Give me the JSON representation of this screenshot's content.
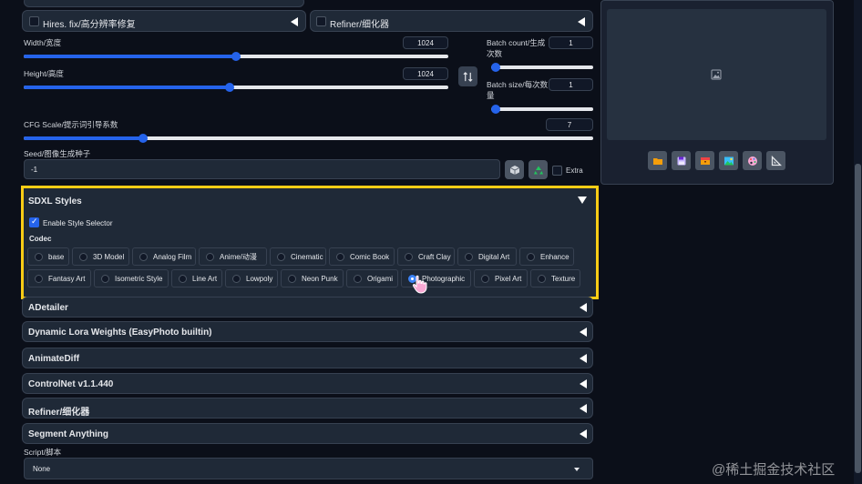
{
  "hires": {
    "label": "Hires. fix/高分辨率修复"
  },
  "refiner_top": {
    "label": "Refiner/细化器"
  },
  "width": {
    "label": "Width/宽度",
    "value": "1024",
    "fraction": 0.5
  },
  "height": {
    "label": "Height/高度",
    "value": "1024",
    "fraction": 0.5
  },
  "batch_count": {
    "label_line1": "Batch count/生成",
    "label_line2": "次数",
    "value": "1",
    "fraction": 0.0
  },
  "batch_size": {
    "label_line1": "Batch size/每次数",
    "label_line2": "量",
    "value": "1",
    "fraction": 0.0
  },
  "swap_icon": "swap-vertical-icon",
  "cfg": {
    "label": "CFG Scale/提示词引导系数",
    "value": "7",
    "fraction": 0.21
  },
  "seed": {
    "label": "Seed/图像生成种子",
    "value": "-1",
    "extra_label": "Extra"
  },
  "sdxl": {
    "title": "SDXL Styles",
    "enable_label": "Enable Style Selector",
    "codec_label": "Codec",
    "selected": "Photographic",
    "highlight_color": "#facc15",
    "row1": [
      "base",
      "3D Model",
      "Analog Film",
      "Anime/动漫",
      "Cinematic",
      "Comic Book",
      "Craft Clay",
      "Digital Art",
      "Enhance"
    ],
    "row2": [
      "Fantasy Art",
      "Isometric Style",
      "Line Art",
      "Lowpoly",
      "Neon Punk",
      "Origami",
      "Photographic",
      "Pixel Art",
      "Texture"
    ]
  },
  "accordions": [
    "ADetailer",
    "Dynamic Lora Weights (EasyPhoto builtin)",
    "AnimateDiff",
    "ControlNet v1.1.440",
    "Refiner/细化器",
    "Segment Anything"
  ],
  "script": {
    "label": "Script/脚本",
    "value": "None"
  },
  "watermark": "@稀土掘金技术社区",
  "accent_color": "#2563eb"
}
